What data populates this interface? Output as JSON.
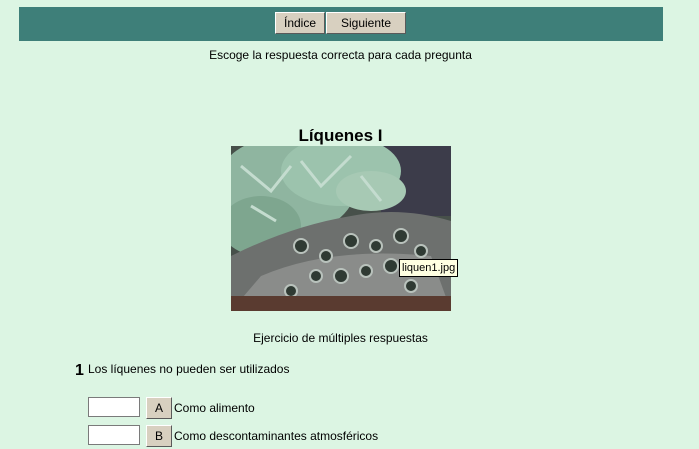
{
  "nav": {
    "index_label": "Índice",
    "next_label": "Siguiente"
  },
  "instructions": "Escoge la respuesta correcta para cada pregunta",
  "quiz": {
    "title": "Líquenes I",
    "image_tooltip": "liquen1.jpg",
    "subtitle": "Ejercicio de múltiples respuestas"
  },
  "question": {
    "number": "1",
    "text": "Los líquenes no pueden ser utilizados",
    "answers": [
      {
        "letter": "A",
        "text": "Como alimento",
        "value": ""
      },
      {
        "letter": "B",
        "text": "Como descontaminantes atmosféricos",
        "value": ""
      }
    ]
  },
  "colors": {
    "background": "#dcf5e3",
    "navbar": "#3e7f79",
    "button": "#d8d0c0"
  }
}
